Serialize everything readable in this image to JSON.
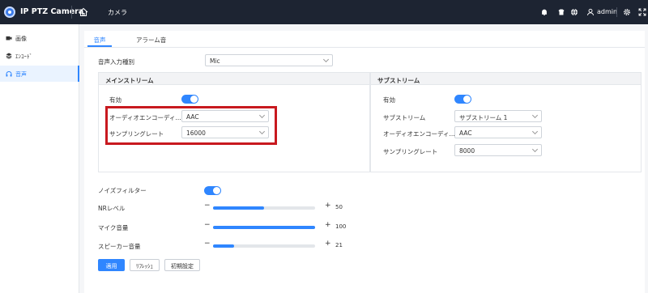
{
  "header": {
    "app_title": "IP PTZ Camera",
    "nav_title": "カメラ",
    "user": "admin"
  },
  "sidebar": {
    "items": [
      {
        "label": "画像",
        "icon": "camera-icon"
      },
      {
        "label": "ｴﾝｺｰﾄﾞ",
        "icon": "layers-icon"
      },
      {
        "label": "音声",
        "icon": "headphones-icon",
        "active": true
      }
    ]
  },
  "tabs": [
    {
      "label": "音声",
      "active": true
    },
    {
      "label": "アラーム音",
      "active": false
    }
  ],
  "audio_input": {
    "label": "音声入力種別",
    "value": "Mic"
  },
  "main_stream": {
    "title": "メインストリーム",
    "enable_label": "有効",
    "enabled": true,
    "encode_label": "オーディオエンコーディ...",
    "encode_value": "AAC",
    "rate_label": "サンプリングレート",
    "rate_value": "16000"
  },
  "sub_stream": {
    "title": "サブストリーム",
    "enable_label": "有効",
    "enabled": true,
    "stream_label": "サブストリーム",
    "stream_value": "サブストリーム 1",
    "encode_label": "オーディオエンコーディ...",
    "encode_value": "AAC",
    "rate_label": "サンプリングレート",
    "rate_value": "8000"
  },
  "noise_filter": {
    "label": "ノイズフィルター",
    "enabled": true
  },
  "sliders": [
    {
      "label": "NRレベル",
      "value": 50,
      "max": 100
    },
    {
      "label": "マイク音量",
      "value": 100,
      "max": 100
    },
    {
      "label": "スピーカー音量",
      "value": 21,
      "max": 100
    }
  ],
  "buttons": {
    "apply": "適用",
    "refresh": "ﾘﾌﾚｯｼｭ",
    "default": "初期設定"
  },
  "colors": {
    "accent": "#2f86ff",
    "topbar": "#1d2432",
    "highlight": "#c8191f"
  }
}
